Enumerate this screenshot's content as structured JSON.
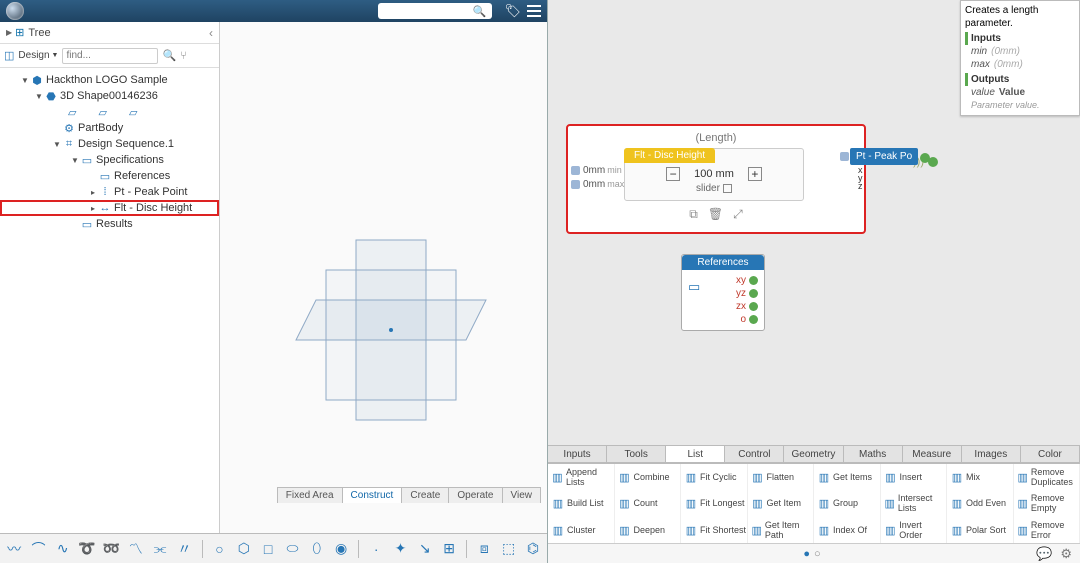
{
  "leftTop": {
    "searchPlaceholder": "",
    "tagIcon": "🏷",
    "menuIcon": "≡"
  },
  "treeHdr": {
    "label": "Tree"
  },
  "filter": {
    "designLabel": "Design",
    "findPlaceholder": "find..."
  },
  "tree": {
    "root": "Hackthon LOGO Sample",
    "shape": "3D Shape00146236",
    "partbody": "PartBody",
    "dseq": "Design Sequence.1",
    "specs": "Specifications",
    "refs": "References",
    "peak": "Pt - Peak Point",
    "disc": "Flt - Disc Height",
    "results": "Results"
  },
  "canvasTabs": [
    "Fixed Area",
    "Construct",
    "Create",
    "Operate",
    "View"
  ],
  "lengthNode": {
    "title": "(Length)",
    "tab": "Flt - Disc Height",
    "leftPorts": [
      {
        "val": "0mm",
        "hint": "min"
      },
      {
        "val": "0mm",
        "hint": "max"
      }
    ],
    "value": "100 mm",
    "sliderLabel": "slider",
    "output": "100mm )))"
  },
  "peakNode": {
    "label": "Pt - Peak Po"
  },
  "refNode": {
    "title": "References",
    "rows": [
      "xy",
      "yz",
      "zx",
      "o"
    ]
  },
  "infoCard": {
    "desc": "Creates a length parameter.",
    "inputsLabel": "Inputs",
    "inputs": [
      {
        "k": "min",
        "v": "(0mm)"
      },
      {
        "k": "max",
        "v": "(0mm)"
      }
    ],
    "outputsLabel": "Outputs",
    "outKey": "value",
    "outVal": "Value",
    "outHint": "Parameter value."
  },
  "toolTabs": [
    "Inputs",
    "Tools",
    "List",
    "Control",
    "Geometry",
    "Maths",
    "Measure",
    "Images",
    "Color"
  ],
  "toolGrid": [
    [
      "Append Lists",
      "Combine",
      "Fit Cyclic",
      "Flatten",
      "Get Items",
      "Insert",
      "Mix",
      "Remove Duplicates"
    ],
    [
      "Build List",
      "Count",
      "Fit Longest",
      "Get Item",
      "Group",
      "Intersect Lists",
      "Odd Even",
      "Remove Empty"
    ],
    [
      "Cluster",
      "Deepen",
      "Fit Shortest",
      "Get Item Path",
      "Index Of",
      "Invert Order",
      "Polar Sort",
      "Remove Error"
    ]
  ]
}
